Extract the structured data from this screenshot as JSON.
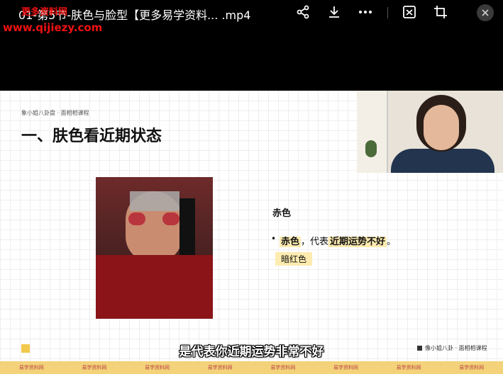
{
  "window": {
    "title": "01-第5节-肤色与脸型【更多易学资料...  .mp4",
    "watermark_top": "更多资料网",
    "watermark_url": "www.qijiezy.com"
  },
  "toolbar": {
    "icons": [
      "share-icon",
      "download-icon",
      "more-icon",
      "screenshot-icon",
      "crop-icon",
      "close-icon"
    ]
  },
  "slide": {
    "tag": "象小姐八卦盘 · 面相相课程",
    "heading": "一、肤色看近期状态",
    "color_label": "赤色",
    "bullet": {
      "term": "赤色",
      "sep": "，代表",
      "highlight": "近期运势不好",
      "end": "。"
    },
    "sub_tag": "暗红色",
    "footer": "像小姐八卦 · 面相相课程"
  },
  "subtitle": "是代表你近期运势非常不好",
  "bottom_strip": {
    "cells": [
      "易学资料网",
      "易学资料网",
      "易学资料网",
      "易学资料网",
      "易学资料网",
      "易学资料网",
      "易学资料网",
      "易学资料网"
    ]
  }
}
